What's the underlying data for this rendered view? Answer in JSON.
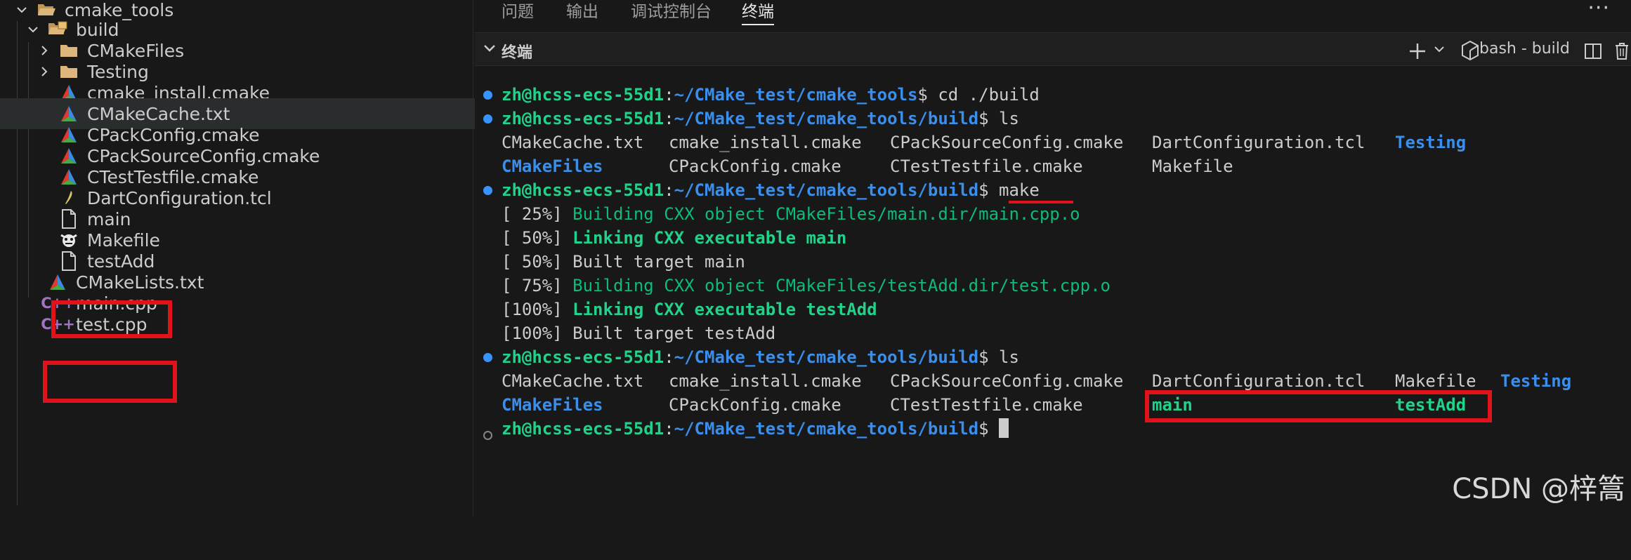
{
  "explorer": {
    "root": {
      "label": "cmake_tools",
      "icon": "folder-open-icon"
    },
    "build": {
      "label": "build",
      "icon": "folder-open-icon"
    },
    "items": [
      {
        "label": "CMakeFiles",
        "icon": "folder-icon"
      },
      {
        "label": "Testing",
        "icon": "folder-icon"
      },
      {
        "label": "cmake_install.cmake",
        "icon": "cmake-icon"
      },
      {
        "label": "CMakeCache.txt",
        "icon": "cmake-icon"
      },
      {
        "label": "CPackConfig.cmake",
        "icon": "cmake-icon"
      },
      {
        "label": "CPackSourceConfig.cmake",
        "icon": "cmake-icon"
      },
      {
        "label": "CTestTestfile.cmake",
        "icon": "cmake-icon"
      },
      {
        "label": "DartConfiguration.tcl",
        "icon": "feather-icon"
      },
      {
        "label": "main",
        "icon": "file-icon"
      },
      {
        "label": "Makefile",
        "icon": "makefile-icon"
      },
      {
        "label": "testAdd",
        "icon": "file-icon"
      }
    ],
    "root_items": [
      {
        "label": "CMakeLists.txt",
        "icon": "cmake-icon"
      },
      {
        "label": "main.cpp",
        "icon": "cpp-icon"
      },
      {
        "label": "test.cpp",
        "icon": "cpp-icon"
      }
    ]
  },
  "panel": {
    "tabs": [
      "问题",
      "输出",
      "调试控制台",
      "终端"
    ],
    "active_tab": "终端",
    "section_title": "终端",
    "shell": "bash - build"
  },
  "terminal": {
    "user": "zh@hcss-ecs-55d1",
    "path": "~/CMake_test/cmake_tools",
    "path_build": "~/CMake_test/cmake_tools/build",
    "cmd_cd": " cd ./build",
    "cmd_ls": " ls",
    "cmd_make": " make",
    "ls1_row1": [
      "CMakeCache.txt",
      "cmake_install.cmake",
      "CPackSourceConfig.cmake",
      "DartConfiguration.tcl",
      "Testing"
    ],
    "ls1_row2": [
      "CMakeFiles",
      "CPackConfig.cmake",
      "CTestTestfile.cmake",
      "Makefile"
    ],
    "make_output": [
      {
        "pct": "[ 25%]",
        "text": " Building CXX object CMakeFiles/main.dir/main.cpp.o"
      },
      {
        "pct": "[ 50%]",
        "text": " Linking CXX executable main"
      },
      {
        "pct": "[ 50%]",
        "text": " Built target main"
      },
      {
        "pct": "[ 75%]",
        "text": " Building CXX object CMakeFiles/testAdd.dir/test.cpp.o"
      },
      {
        "pct": "[100%]",
        "text": " Linking CXX executable testAdd"
      },
      {
        "pct": "[100%]",
        "text": " Built target testAdd"
      }
    ],
    "ls2_row1": [
      "CMakeCache.txt",
      "cmake_install.cmake",
      "CPackSourceConfig.cmake",
      "DartConfiguration.tcl",
      "Makefile",
      "Testing"
    ],
    "ls2_row2": [
      "CMakeFiles",
      "CPackConfig.cmake",
      "CTestTestfile.cmake",
      "main",
      "testAdd"
    ],
    "prompt_suffix": "$"
  },
  "watermark": "CSDN @梓篙"
}
